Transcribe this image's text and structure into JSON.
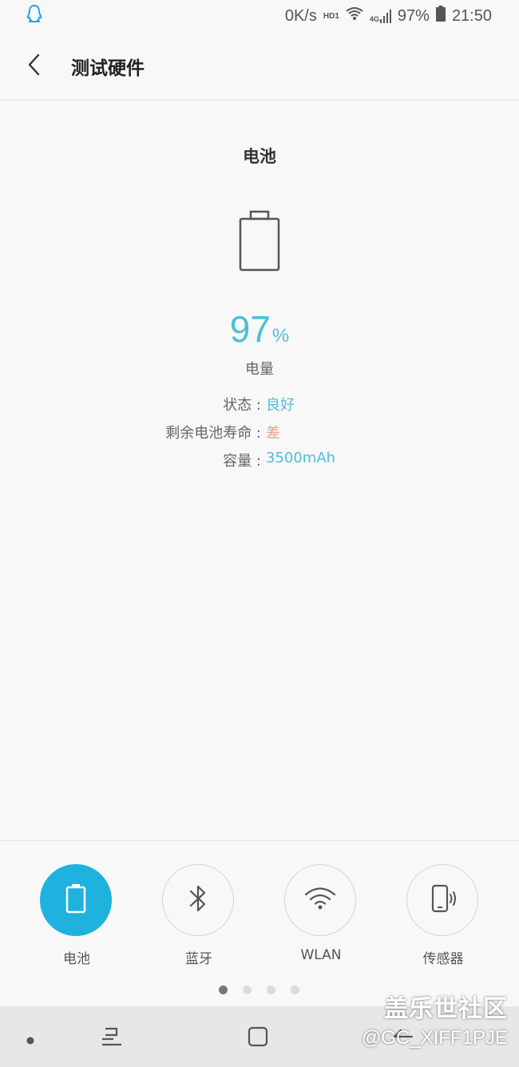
{
  "status_bar": {
    "speed": "0K/s",
    "hd_label": "HD1",
    "network_label": "4G",
    "battery_text": "97%",
    "time": "21:50"
  },
  "header": {
    "title": "测试硬件"
  },
  "battery": {
    "section_title": "电池",
    "percent": "97",
    "percent_unit": "%",
    "charge_label": "电量",
    "info": [
      {
        "label": "状态 :",
        "value": "良好"
      },
      {
        "label": "剩余电池寿命 :",
        "value": "差"
      },
      {
        "label": "容量 :",
        "value": "3500mAh"
      }
    ]
  },
  "tools": [
    {
      "label": "电池",
      "icon": "battery-icon",
      "active": true
    },
    {
      "label": "蓝牙",
      "icon": "bluetooth-icon",
      "active": false
    },
    {
      "label": "WLAN",
      "icon": "wifi-icon",
      "active": false
    },
    {
      "label": "传感器",
      "icon": "phone-vibrate-icon",
      "active": false
    }
  ],
  "pager": {
    "pages": 4,
    "current": 1
  },
  "watermark": {
    "line1": "盖乐世社区",
    "line2": "@GC_XIFF1PJE"
  },
  "colors": {
    "accent": "#1fb2de",
    "value_good": "#4bbfd9",
    "value_bad": "#e3a48a"
  }
}
